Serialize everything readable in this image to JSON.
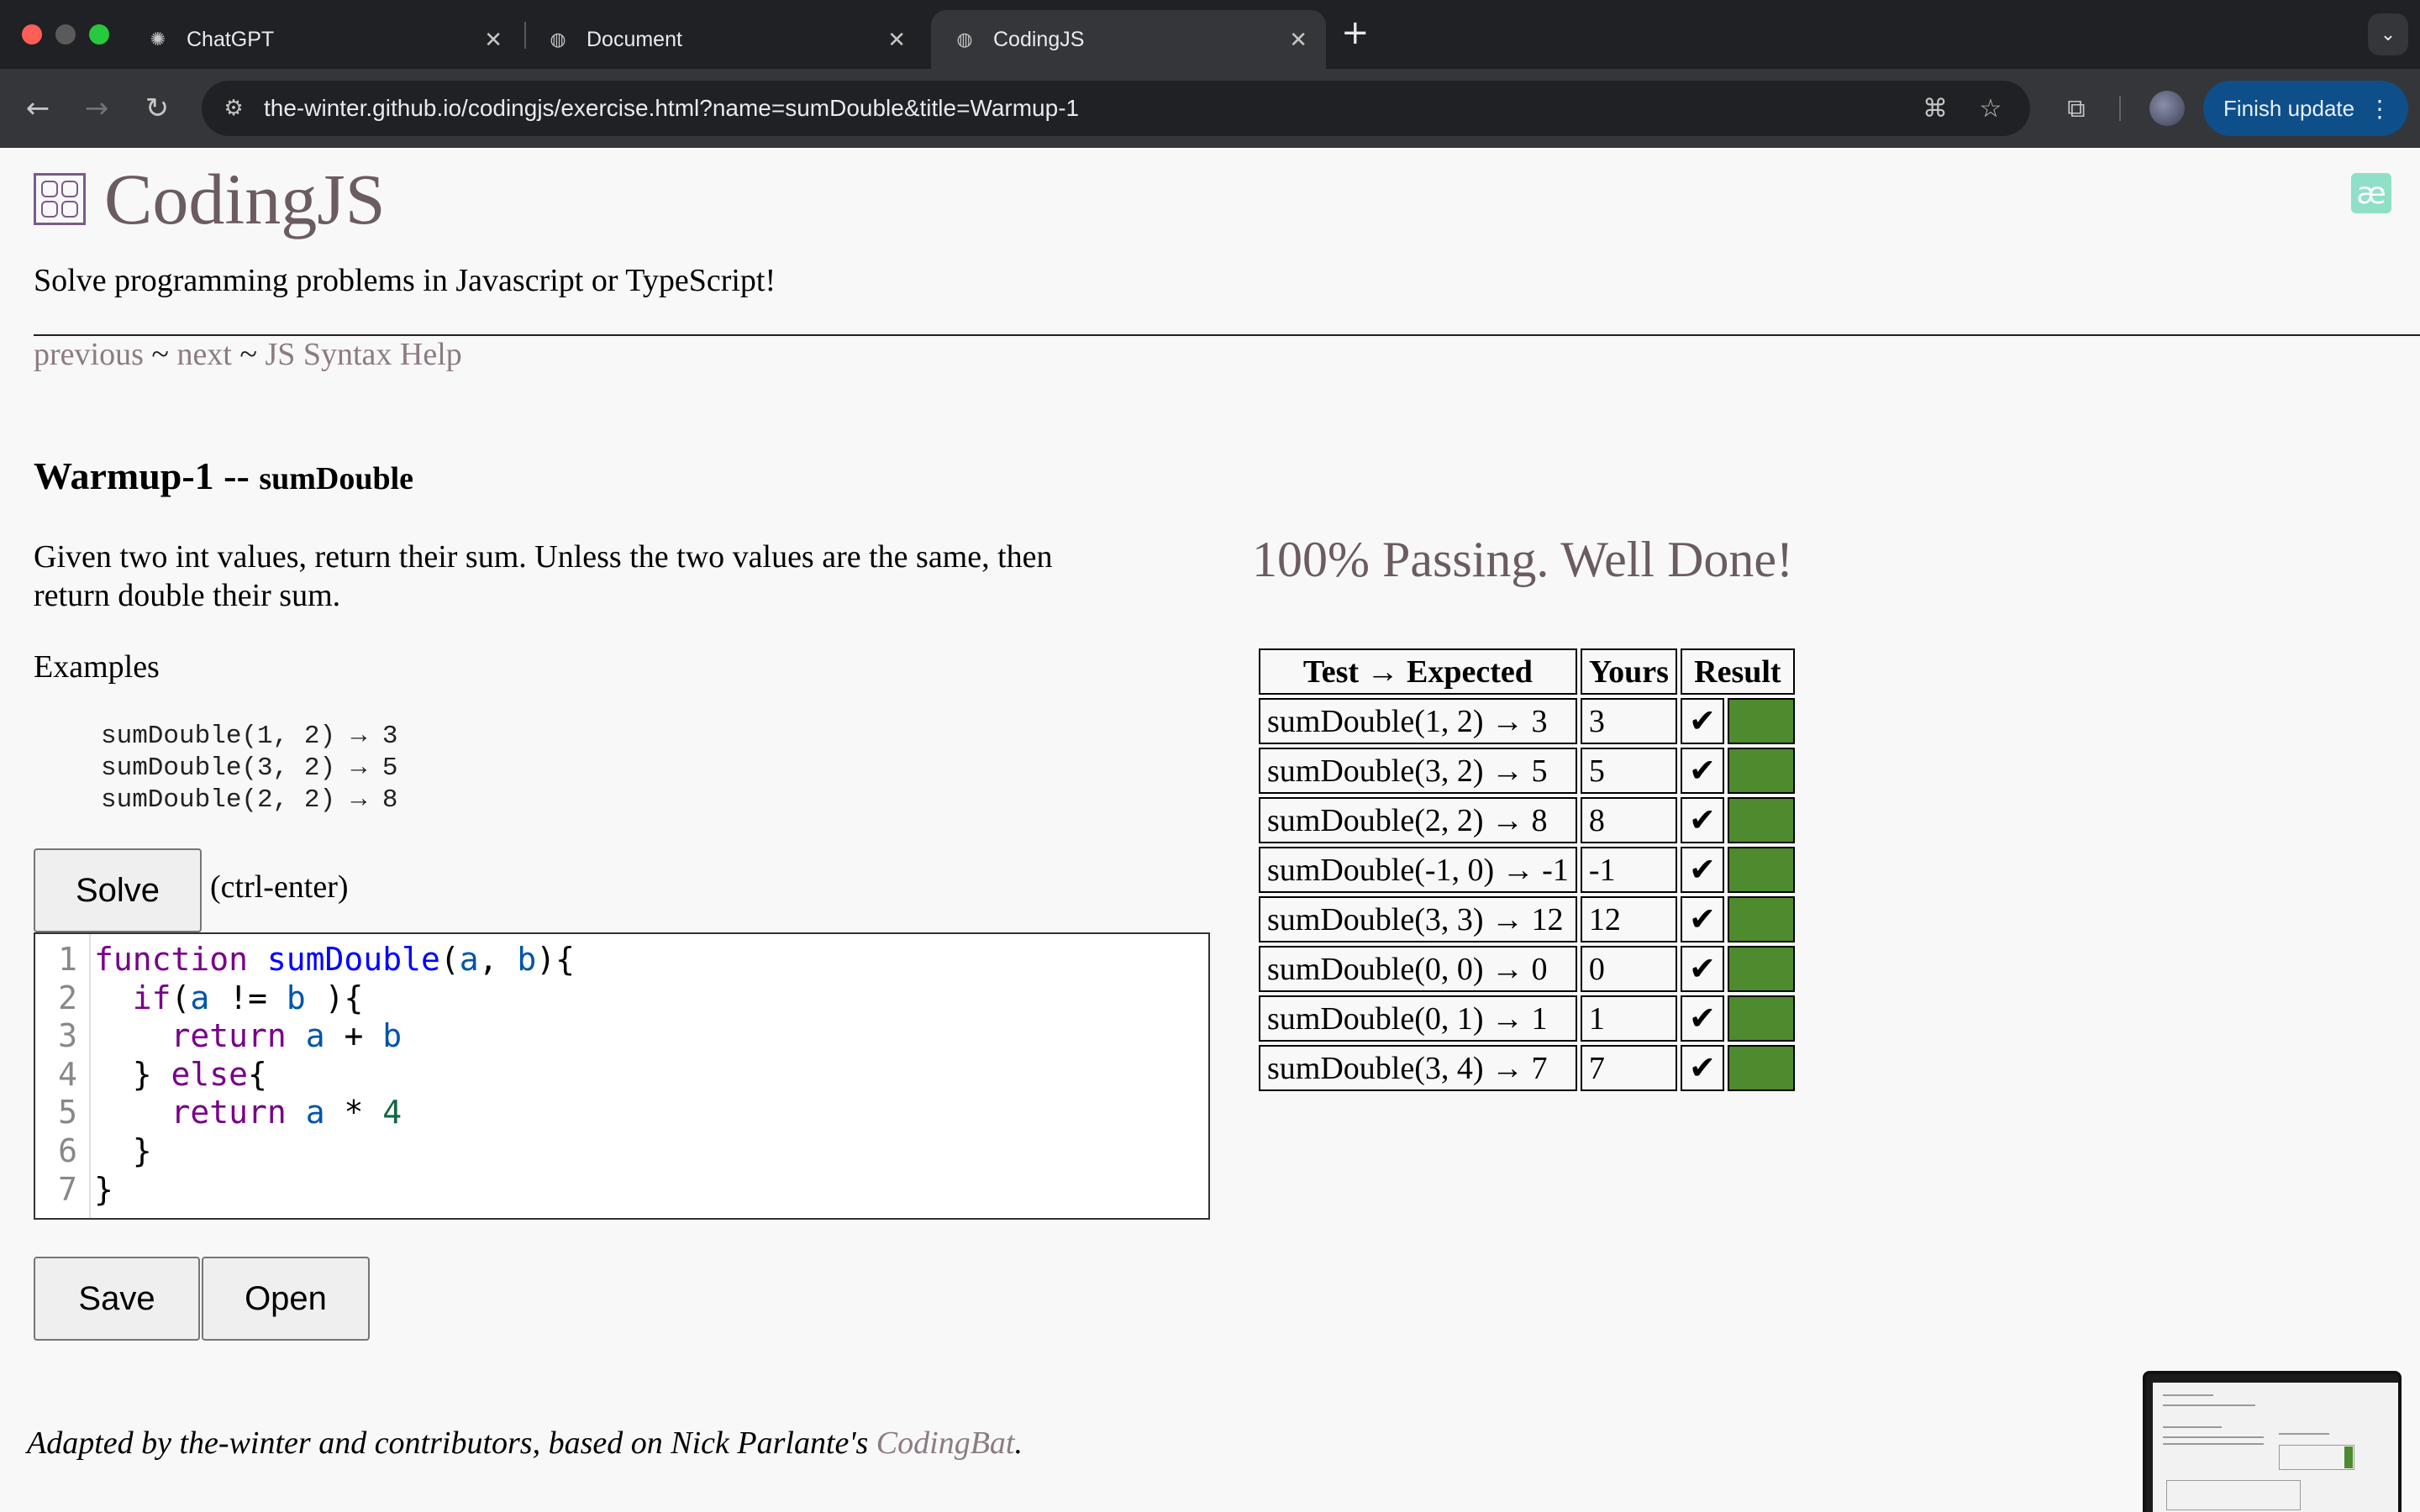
{
  "browser": {
    "tabs": [
      {
        "title": "ChatGPT",
        "icon": "openai-icon",
        "active": false
      },
      {
        "title": "Document",
        "icon": "globe-icon",
        "active": false
      },
      {
        "title": "CodingJS",
        "icon": "globe-icon",
        "active": true
      }
    ],
    "url": "the-winter.github.io/codingjs/exercise.html?name=sumDouble&title=Warmup-1",
    "finish_update_label": "Finish update"
  },
  "site": {
    "title": "CodingJS",
    "tagline": "Solve programming problems in Javascript or TypeScript!",
    "nav": {
      "previous": "previous",
      "sep": "~",
      "next": "next",
      "help": "JS Syntax Help"
    }
  },
  "exercise": {
    "category": "Warmup-1 --",
    "name": "sumDouble",
    "description": "Given two int values, return their sum. Unless the two values are the same, then return double their sum.",
    "examples_label": "Examples",
    "examples": [
      "sumDouble(1, 2) → 3",
      "sumDouble(3, 2) → 5",
      "sumDouble(2, 2) → 8"
    ]
  },
  "controls": {
    "solve_label": "Solve",
    "solve_hint": "(ctrl-enter)",
    "save_label": "Save",
    "open_label": "Open"
  },
  "editor": {
    "line_numbers": [
      "1",
      "2",
      "3",
      "4",
      "5",
      "6",
      "7"
    ]
  },
  "results": {
    "status": "100% Passing. Well Done!",
    "headers": [
      "Test → Expected",
      "Yours",
      "Result"
    ],
    "rows": [
      {
        "test": "sumDouble(1, 2) → 3",
        "yours": "3",
        "mark": "✔"
      },
      {
        "test": "sumDouble(3, 2) → 5",
        "yours": "5",
        "mark": "✔"
      },
      {
        "test": "sumDouble(2, 2) → 8",
        "yours": "8",
        "mark": "✔"
      },
      {
        "test": "sumDouble(-1, 0) → -1",
        "yours": "-1",
        "mark": "✔"
      },
      {
        "test": "sumDouble(3, 3) → 12",
        "yours": "12",
        "mark": "✔"
      },
      {
        "test": "sumDouble(0, 0) → 0",
        "yours": "0",
        "mark": "✔"
      },
      {
        "test": "sumDouble(0, 1) → 1",
        "yours": "1",
        "mark": "✔"
      },
      {
        "test": "sumDouble(3, 4) → 7",
        "yours": "7",
        "mark": "✔"
      }
    ],
    "pass_color": "#4e8a2e"
  },
  "footer": {
    "text": "Adapted by the-winter and contributors, based on Nick Parlante's",
    "link": "CodingBat",
    "end": "."
  }
}
